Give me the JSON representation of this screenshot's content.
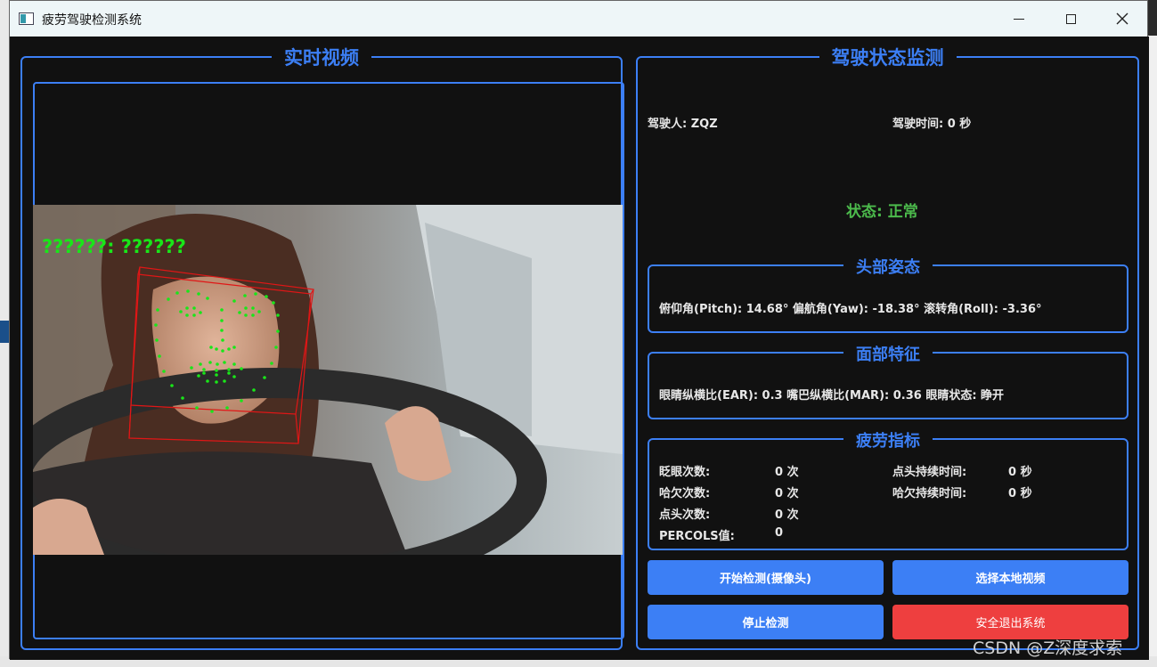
{
  "window": {
    "title": "疲劳驾驶检测系统"
  },
  "video_panel": {
    "title": "实时视频",
    "overlay_text": "??????: ??????"
  },
  "monitor_panel": {
    "title": "驾驶状态监测",
    "driver": "驾驶人: ZQZ",
    "drive_time": "驾驶时间: 0 秒",
    "status": "状态: 正常"
  },
  "head_pose": {
    "title": "头部姿态",
    "text": "俯仰角(Pitch): 14.68°  偏航角(Yaw): -18.38°  滚转角(Roll): -3.36°"
  },
  "face_features": {
    "title": "面部特征",
    "text": "眼睛纵横比(EAR): 0.3   嘴巴纵横比(MAR): 0.36  眼睛状态: 睁开"
  },
  "fatigue": {
    "title": "疲劳指标",
    "blink_label": "眨眼次数:",
    "blink_value": "0 次",
    "yawn_label": "哈欠次数:",
    "yawn_value": "0 次",
    "nod_label": "点头次数:",
    "nod_value": "0 次",
    "perclos_label": "PERCOLS值:",
    "perclos_value": "0",
    "nod_duration_label": "点头持续时间:",
    "nod_duration_value": "0 秒",
    "yawn_duration_label": "哈欠持续时间:",
    "yawn_duration_value": "0 秒"
  },
  "buttons": {
    "start_camera": "开始检测(摄像头)",
    "select_video": "选择本地视频",
    "stop": "停止检测",
    "exit": "安全退出系统"
  },
  "watermark": "CSDN @Z深度求索",
  "colors": {
    "accent": "#3c7ff5",
    "status_ok": "#4cbb4c",
    "exit": "#ee3f3f",
    "landmark": "#19e619",
    "head_box": "#e01616"
  }
}
